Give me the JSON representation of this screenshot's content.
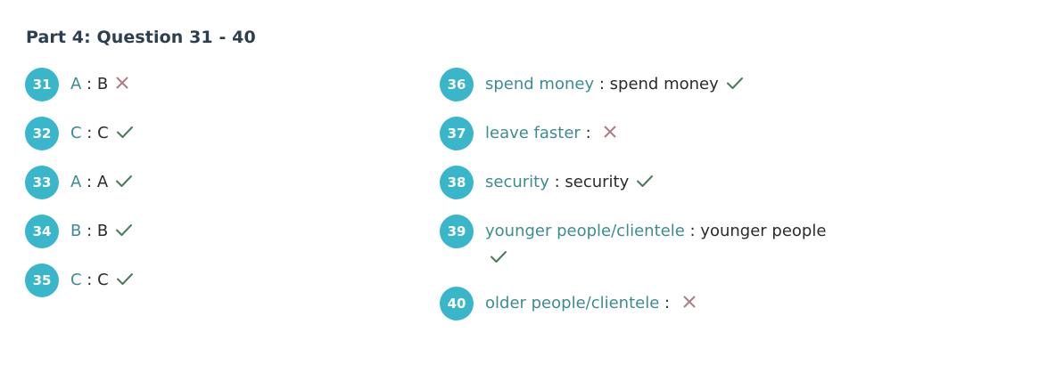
{
  "title": "Part 4: Question 31 - 40",
  "left_items": [
    {
      "num": "31",
      "correct": "A",
      "sep": " : ",
      "user": "B",
      "result": "wrong"
    },
    {
      "num": "32",
      "correct": "C",
      "sep": " : ",
      "user": "C",
      "result": "right"
    },
    {
      "num": "33",
      "correct": "A",
      "sep": " : ",
      "user": "A",
      "result": "right"
    },
    {
      "num": "34",
      "correct": "B",
      "sep": " : ",
      "user": "B",
      "result": "right"
    },
    {
      "num": "35",
      "correct": "C",
      "sep": " : ",
      "user": "C",
      "result": "right"
    }
  ],
  "right_items": [
    {
      "num": "36",
      "correct": "spend money",
      "sep": " : ",
      "user": "spend money",
      "result": "right"
    },
    {
      "num": "37",
      "correct": "leave faster",
      "sep": " : ",
      "user": "",
      "result": "wrong"
    },
    {
      "num": "38",
      "correct": "security",
      "sep": " : ",
      "user": "security",
      "result": "right"
    },
    {
      "num": "39",
      "correct": "younger people/clientele",
      "sep": " : ",
      "user": "younger people",
      "result": "right"
    },
    {
      "num": "40",
      "correct": "older people/clientele",
      "sep": " : ",
      "user": "",
      "result": "wrong"
    }
  ],
  "colors": {
    "badge": "#3ab6cb",
    "correct_text": "#3c8c96",
    "check": "#4a7a5c",
    "cross": "#b07a86",
    "title": "#2c3e50"
  },
  "icons": {
    "right": "check-icon",
    "wrong": "cross-icon"
  }
}
